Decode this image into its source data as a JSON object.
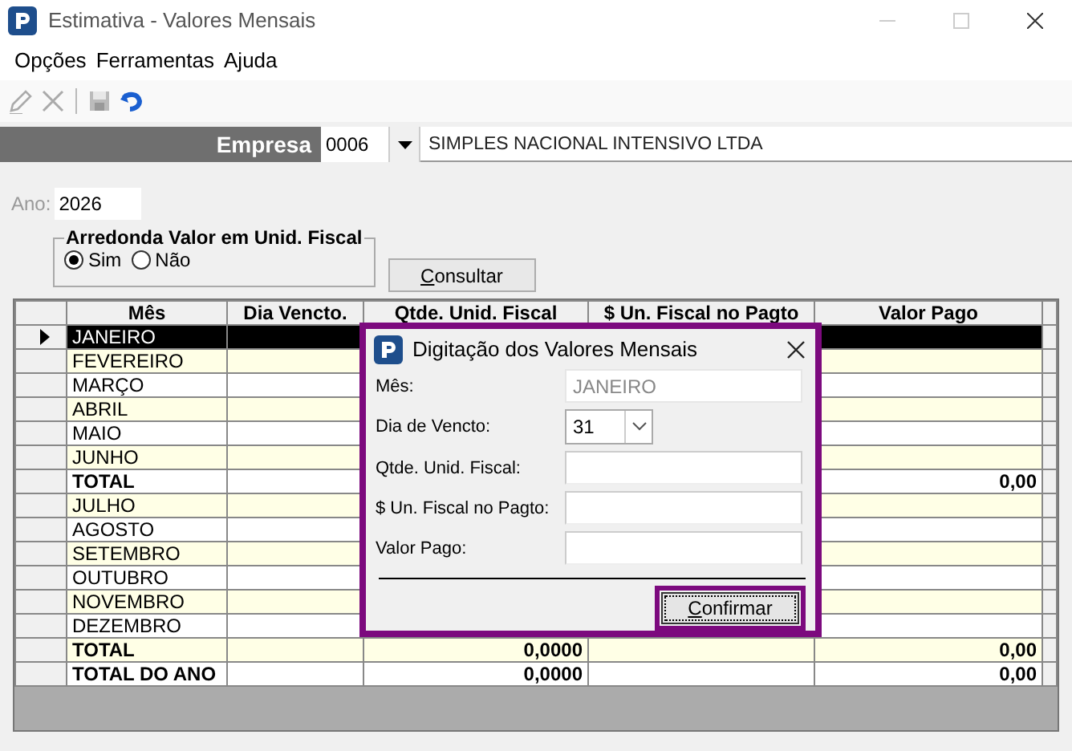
{
  "window": {
    "title": "Estimativa - Valores Mensais"
  },
  "menu": [
    "Opções",
    "Ferramentas",
    "Ajuda"
  ],
  "empresa": {
    "label": "Empresa",
    "code": "0006",
    "name": "SIMPLES NACIONAL INTENSIVO LTDA"
  },
  "ano": {
    "label": "Ano:",
    "value": "2026"
  },
  "arredonda": {
    "title": "Arredonda Valor em Unid. Fiscal",
    "options": [
      {
        "label": "Sim",
        "selected": true
      },
      {
        "label": "Não",
        "selected": false
      }
    ]
  },
  "consultar": "Consultar",
  "table": {
    "columns": [
      "Mês",
      "Dia Vencto.",
      "Qtde. Unid. Fiscal",
      "$ Un. Fiscal no Pagto",
      "Valor Pago"
    ],
    "rows": [
      {
        "month": "JANEIRO",
        "kind": "month",
        "selected": true
      },
      {
        "month": "FEVEREIRO",
        "kind": "month",
        "selected": false
      },
      {
        "month": "MARÇO",
        "kind": "month",
        "selected": false
      },
      {
        "month": "ABRIL",
        "kind": "month",
        "selected": false
      },
      {
        "month": "MAIO",
        "kind": "month",
        "selected": false
      },
      {
        "month": "JUNHO",
        "kind": "month",
        "selected": false
      },
      {
        "month": "TOTAL",
        "kind": "total",
        "selected": false,
        "valor": "0,00"
      },
      {
        "month": "JULHO",
        "kind": "month",
        "selected": false
      },
      {
        "month": "AGOSTO",
        "kind": "month",
        "selected": false
      },
      {
        "month": "SETEMBRO",
        "kind": "month",
        "selected": false
      },
      {
        "month": "OUTUBRO",
        "kind": "month",
        "selected": false
      },
      {
        "month": "NOVEMBRO",
        "kind": "month",
        "selected": false
      },
      {
        "month": "DEZEMBRO",
        "kind": "month",
        "selected": false
      },
      {
        "month": "TOTAL",
        "kind": "total",
        "selected": false,
        "qtde": "0,0000",
        "valor": "0,00"
      },
      {
        "month": "TOTAL DO ANO",
        "kind": "total",
        "selected": false,
        "qtde": "0,0000",
        "valor": "0,00"
      }
    ]
  },
  "dialog": {
    "title": "Digitação dos Valores Mensais",
    "fields": [
      {
        "label": "Mês:",
        "kind": "readonly",
        "value": "JANEIRO"
      },
      {
        "label": "Dia de Vencto:",
        "kind": "select",
        "value": "31"
      },
      {
        "label": "Qtde. Unid. Fiscal:",
        "kind": "text"
      },
      {
        "label": "$ Un. Fiscal no Pagto:",
        "kind": "text"
      },
      {
        "label": "Valor Pago:",
        "kind": "text"
      }
    ],
    "button": "Confirmar"
  }
}
